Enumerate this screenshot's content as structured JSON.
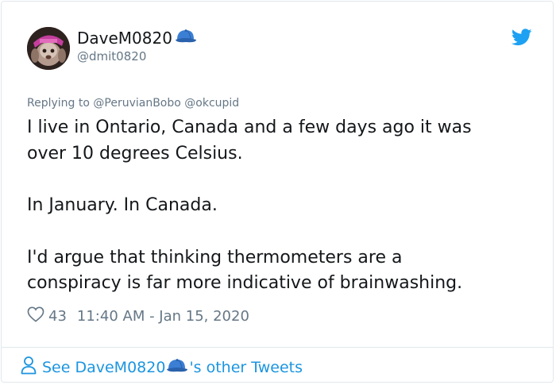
{
  "tweet": {
    "display_name": "DaveM0820",
    "handle": "@dmit0820",
    "name_emoji": "blue-cap-icon",
    "replying_prefix": "Replying to ",
    "replying_to": [
      "@PeruvianBobo",
      "@okcupid"
    ],
    "paragraphs": [
      [
        "I live in Ontario, Canada and a few days ago it was",
        "over 10 degrees Celsius."
      ],
      [
        "In January. In Canada."
      ],
      [
        "I'd argue that thinking thermometers are a",
        "conspiracy is far more indicative of brainwashing."
      ]
    ],
    "likes": "43",
    "timestamp": "11:40 AM - Jan 15, 2020"
  },
  "footer": {
    "prefix": "See DaveM0820",
    "suffix": "'s other Tweets"
  },
  "colors": {
    "accent": "#1b95e0",
    "twitter_blue": "#1da1f2",
    "secondary_text": "#657786",
    "border": "#e1e8ed"
  }
}
